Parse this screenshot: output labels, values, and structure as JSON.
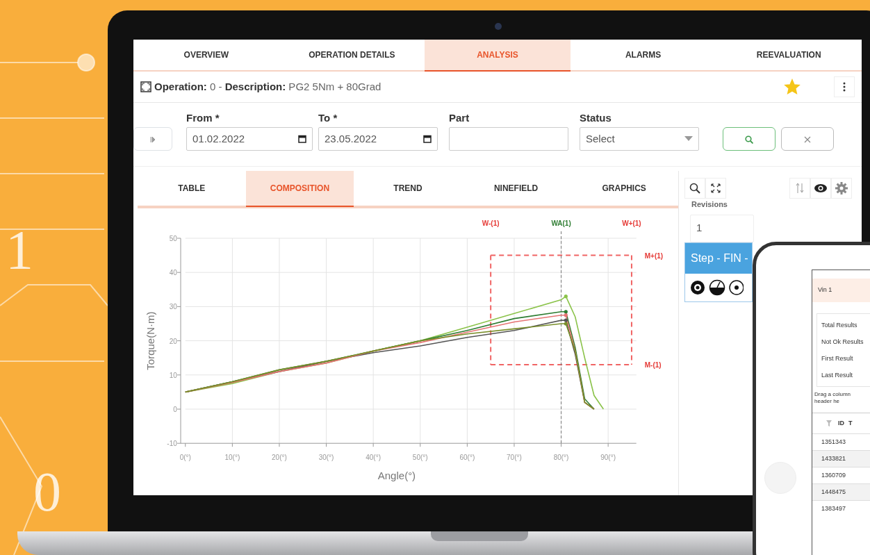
{
  "background": {
    "digits": [
      "1",
      "0"
    ]
  },
  "tabs": [
    {
      "label": "OVERVIEW",
      "selected": false
    },
    {
      "label": "OPERATION DETAILS",
      "selected": false
    },
    {
      "label": "ANALYSIS",
      "selected": true
    },
    {
      "label": "ALARMS",
      "selected": false
    },
    {
      "label": "REEVALUATION",
      "selected": false
    }
  ],
  "operation": {
    "text": "**Operation:** 0 - **Description:** PG2 5Nm + 80Grad",
    "favorite": true
  },
  "filters": {
    "from": {
      "label": "From *",
      "value": "01.02.2022"
    },
    "to": {
      "label": "To *",
      "value": "23.05.2022"
    },
    "part": {
      "label": "Part"
    },
    "status": {
      "label": "Status",
      "placeholder": "Select"
    }
  },
  "subtabs": [
    {
      "label": "TABLE",
      "selected": false
    },
    {
      "label": "COMPOSITION",
      "selected": true
    },
    {
      "label": "TREND",
      "selected": false
    },
    {
      "label": "NINEFIELD",
      "selected": false
    },
    {
      "label": "GRAPHICS",
      "selected": false
    }
  ],
  "chart_data": {
    "type": "line",
    "xlabel": "Angle(°)",
    "ylabel": "Torque(N·m)",
    "x": [
      0,
      10,
      20,
      30,
      40,
      50,
      60,
      70,
      80,
      81,
      83,
      85,
      87,
      89
    ],
    "series": [
      {
        "color": "#8bc34a",
        "values": [
          5,
          7.5,
          11,
          13.5,
          17,
          20,
          24,
          28,
          32,
          33,
          27,
          15,
          4,
          0
        ]
      },
      {
        "color": "#2e7d32",
        "values": [
          5,
          8,
          11.5,
          14,
          17,
          20,
          23,
          26.5,
          28.5,
          28.5,
          18,
          3,
          0,
          null
        ]
      },
      {
        "color": "#555555",
        "values": [
          5,
          8,
          11,
          14,
          16.5,
          18.5,
          21,
          23,
          26,
          26,
          16,
          2,
          0,
          null
        ]
      },
      {
        "color": "#e57373",
        "values": [
          5,
          7.8,
          11,
          13.5,
          17,
          19.5,
          22.5,
          25.5,
          27.5,
          27.5,
          17,
          2,
          0,
          null
        ]
      },
      {
        "color": "#7a8f2a",
        "values": [
          5,
          8,
          11.5,
          14,
          17,
          20,
          22,
          23.5,
          25,
          25,
          17,
          2,
          0,
          null
        ]
      }
    ],
    "xlim": [
      -1,
      96
    ],
    "ylim": [
      -10,
      50
    ],
    "grid": true,
    "xticks": [
      {
        "value": 0,
        "label": "0(°)"
      },
      {
        "value": 10,
        "label": "10(°)"
      },
      {
        "value": 20,
        "label": "20(°)"
      },
      {
        "value": 30,
        "label": "30(°)"
      },
      {
        "value": 40,
        "label": "40(°)"
      },
      {
        "value": 50,
        "label": "50(°)"
      },
      {
        "value": 60,
        "label": "60(°)"
      },
      {
        "value": 70,
        "label": "70(°)"
      },
      {
        "value": 80,
        "label": "80(°)"
      },
      {
        "value": 90,
        "label": "90(°)"
      }
    ],
    "yticks": [
      -10,
      0,
      10,
      20,
      30,
      40,
      50
    ],
    "annotations": [
      "W-(1)",
      "WA(1)",
      "W+(1)",
      "M+(1)",
      "M-(1)"
    ],
    "ref_lines": [
      {
        "axis": "x",
        "value": 65
      },
      {
        "axis": "x",
        "value": 80
      },
      {
        "axis": "x",
        "value": 95
      },
      {
        "axis": "y",
        "value": 45
      },
      {
        "axis": "y",
        "value": 13
      }
    ]
  },
  "side_panel": {
    "revisions_label": "Revisions",
    "revision": "1",
    "step": "Step - FIN -"
  },
  "phone": {
    "title": "Vin 1",
    "stats": [
      "Total Results",
      "Not Ok Results",
      "First Result",
      "Last Result"
    ],
    "hint": "Drag a column header he",
    "columns": [
      "ID",
      "T"
    ],
    "rows": [
      {
        "id": "1351343"
      },
      {
        "id": "1433821"
      },
      {
        "id": "1360709"
      },
      {
        "id": "1448475"
      },
      {
        "id": "1383497"
      }
    ]
  }
}
